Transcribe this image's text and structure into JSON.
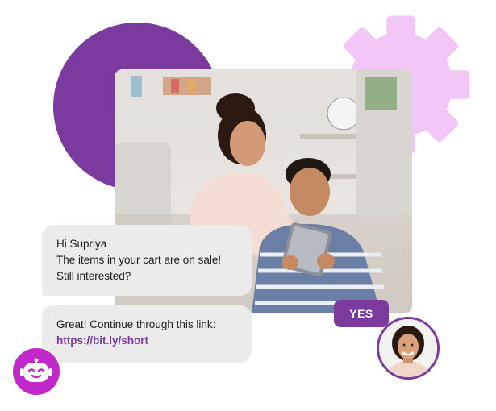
{
  "chat": {
    "message_1": {
      "greeting": "Hi Supriya",
      "line_2": "The items in your cart are on sale!",
      "line_3": "Still interested?"
    },
    "message_2": {
      "text": "Great! Continue through this link:",
      "link": "https://bit.ly/short"
    },
    "reply_button": "YES"
  },
  "icons": {
    "bot": "chatbot-icon",
    "gear": "gear-icon",
    "avatar": "customer-avatar"
  },
  "colors": {
    "brand_purple": "#7b3a9e",
    "gear_lavender": "#f2c6f7",
    "bot_magenta": "#c127c9",
    "bubble_gray": "#ebebeb"
  }
}
